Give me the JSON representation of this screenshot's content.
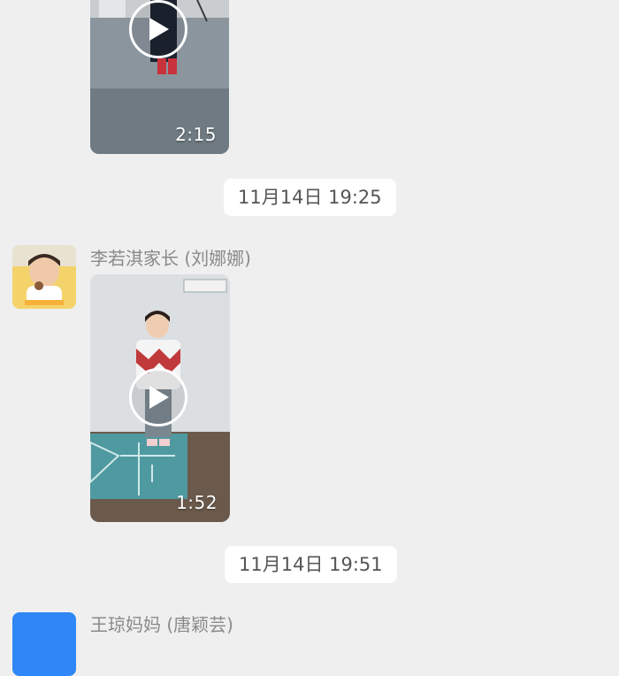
{
  "messages": [
    {
      "video_duration": "2:15"
    },
    {
      "timestamp": "11月14日 19:25"
    },
    {
      "sender": "李若淇家长 (刘娜娜)",
      "avatar_icon": "child-photo-avatar",
      "video_duration": "1:52"
    },
    {
      "timestamp": "11月14日 19:51"
    },
    {
      "sender": "王琼妈妈 (唐颖芸)",
      "avatar_icon": "blue-avatar"
    }
  ],
  "colors": {
    "background": "#efefef",
    "bubble": "#ffffff",
    "sender_text": "#8a8a8a",
    "timestamp_text": "#555555",
    "avatar_blue": "#2f86f6"
  }
}
